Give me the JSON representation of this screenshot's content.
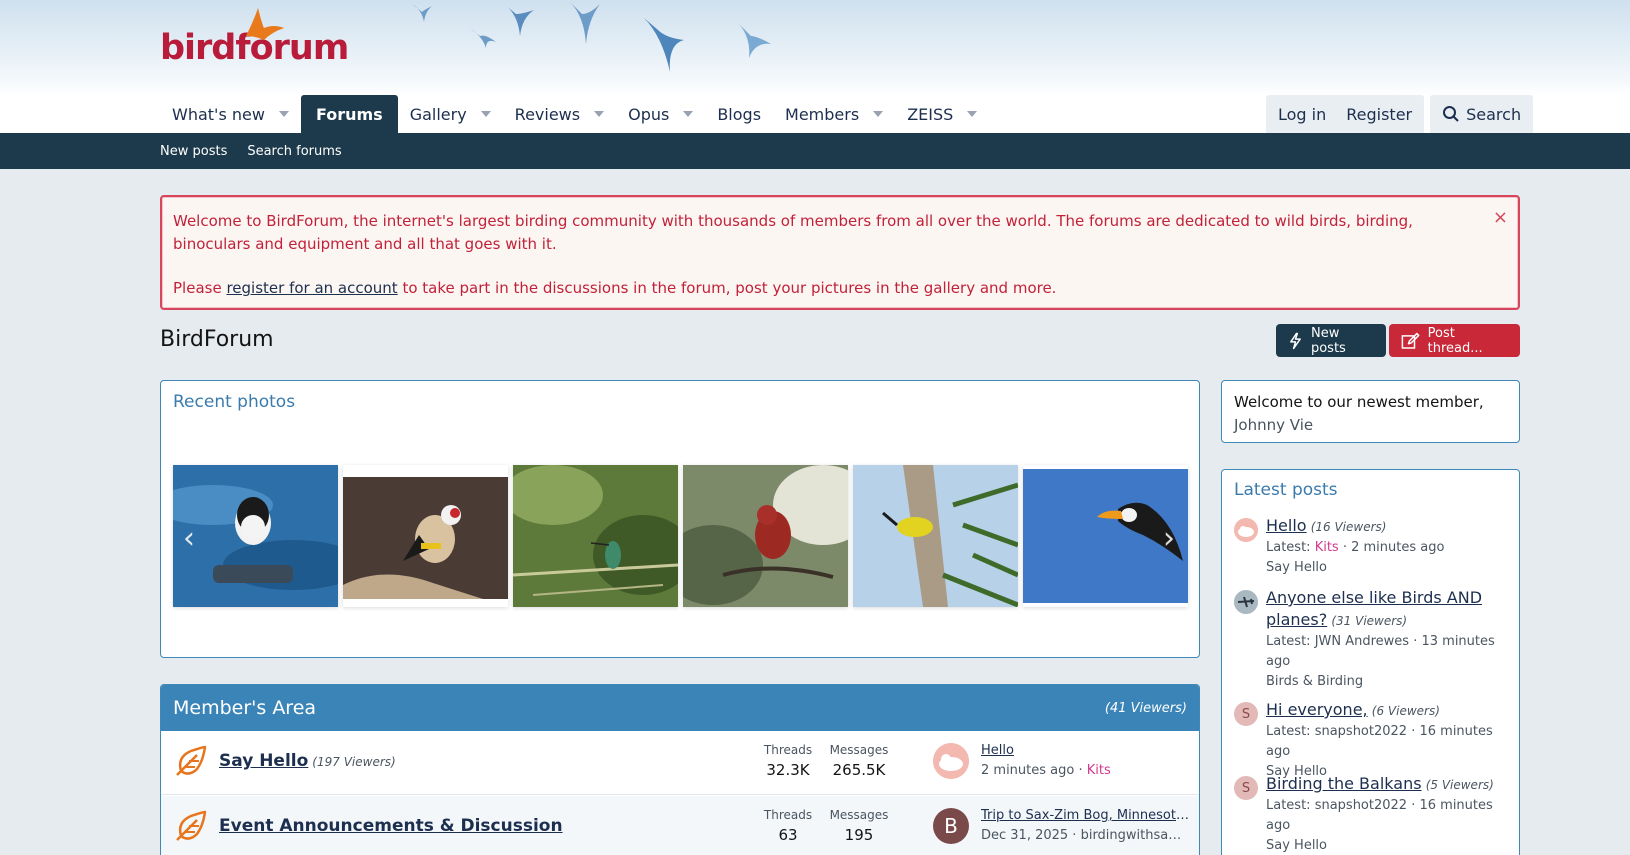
{
  "logo": {
    "text": "birdforum"
  },
  "nav": {
    "tabs": [
      {
        "label": "What's new",
        "has_menu": true
      },
      {
        "label": "Forums",
        "active": true
      },
      {
        "label": "Gallery",
        "has_menu": true
      },
      {
        "label": "Reviews",
        "has_menu": true
      },
      {
        "label": "Opus",
        "has_menu": true
      },
      {
        "label": "Blogs"
      },
      {
        "label": "Members",
        "has_menu": true
      },
      {
        "label": "ZEISS",
        "has_menu": true
      }
    ],
    "login": "Log in",
    "register": "Register",
    "search": "Search"
  },
  "subnav": {
    "new_posts": "New posts",
    "search_forums": "Search forums"
  },
  "notice": {
    "line1": "Welcome to BirdForum, the internet's largest birding community with thousands of members from all over the world. The forums are dedicated to wild birds, birding, binoculars and equipment and all that goes with it.",
    "line2_pre": "Please ",
    "line2_link": "register for an account",
    "line2_post": " to take part in the discussions in the forum, post your pictures in the gallery and more.",
    "close": "×"
  },
  "page": {
    "title": "BirdForum",
    "new_posts_btn": "New posts",
    "post_thread_btn": "Post thread..."
  },
  "recent_photos": {
    "title": "Recent photos"
  },
  "sidebar": {
    "welcome_text": "Welcome to our newest member,",
    "newest_member": "Johnny Vie",
    "latest_title": "Latest posts",
    "posts": [
      {
        "title": "Hello",
        "viewers": "(16 Viewers)",
        "latest_prefix": "Latest: ",
        "user": "Kits",
        "time": " · 2 minutes ago",
        "forum": "Say Hello"
      },
      {
        "title": "Anyone else like Birds AND planes?",
        "viewers": "(31 Viewers)",
        "latest_prefix": "Latest: ",
        "user": "JWN Andrewes",
        "time": " · 13 minutes ago",
        "forum": "Birds & Birding"
      },
      {
        "title": "Hi everyone,",
        "viewers": "(6 Viewers)",
        "latest_prefix": "Latest: ",
        "user": "snapshot2022",
        "time": " · 16 minutes ago",
        "forum": "Say Hello",
        "avatar_letter": "S"
      },
      {
        "title": "Birding the Balkans",
        "viewers": "(5 Viewers)",
        "latest_prefix": "Latest: ",
        "user": "snapshot2022",
        "time": " · 16 minutes ago",
        "forum": "Say Hello",
        "avatar_letter": "S"
      }
    ]
  },
  "member_area": {
    "title": "Member's Area",
    "viewers": "(41 Viewers)",
    "threads_label": "Threads",
    "messages_label": "Messages",
    "forums": [
      {
        "name": "Say Hello",
        "viewers": "(197 Viewers)",
        "threads": "32.3K",
        "messages": "265.5K",
        "latest_title": "Hello",
        "latest_time": "2 minutes ago · ",
        "latest_user": "Kits"
      },
      {
        "name": "Event Announcements & Discussion",
        "viewers": "",
        "threads": "63",
        "messages": "195",
        "latest_title": "Trip to Sax-Zim Bog, Minnesota ...",
        "latest_time": "Dec 31, 2025 · ",
        "latest_user": "birdingwithsammy",
        "avatar_letter": "B"
      }
    ]
  },
  "colors": {
    "brand": "#b81c3a",
    "nav_dark": "#1c3a4b",
    "accent_blue": "#3b84b8",
    "danger": "#c82838"
  }
}
